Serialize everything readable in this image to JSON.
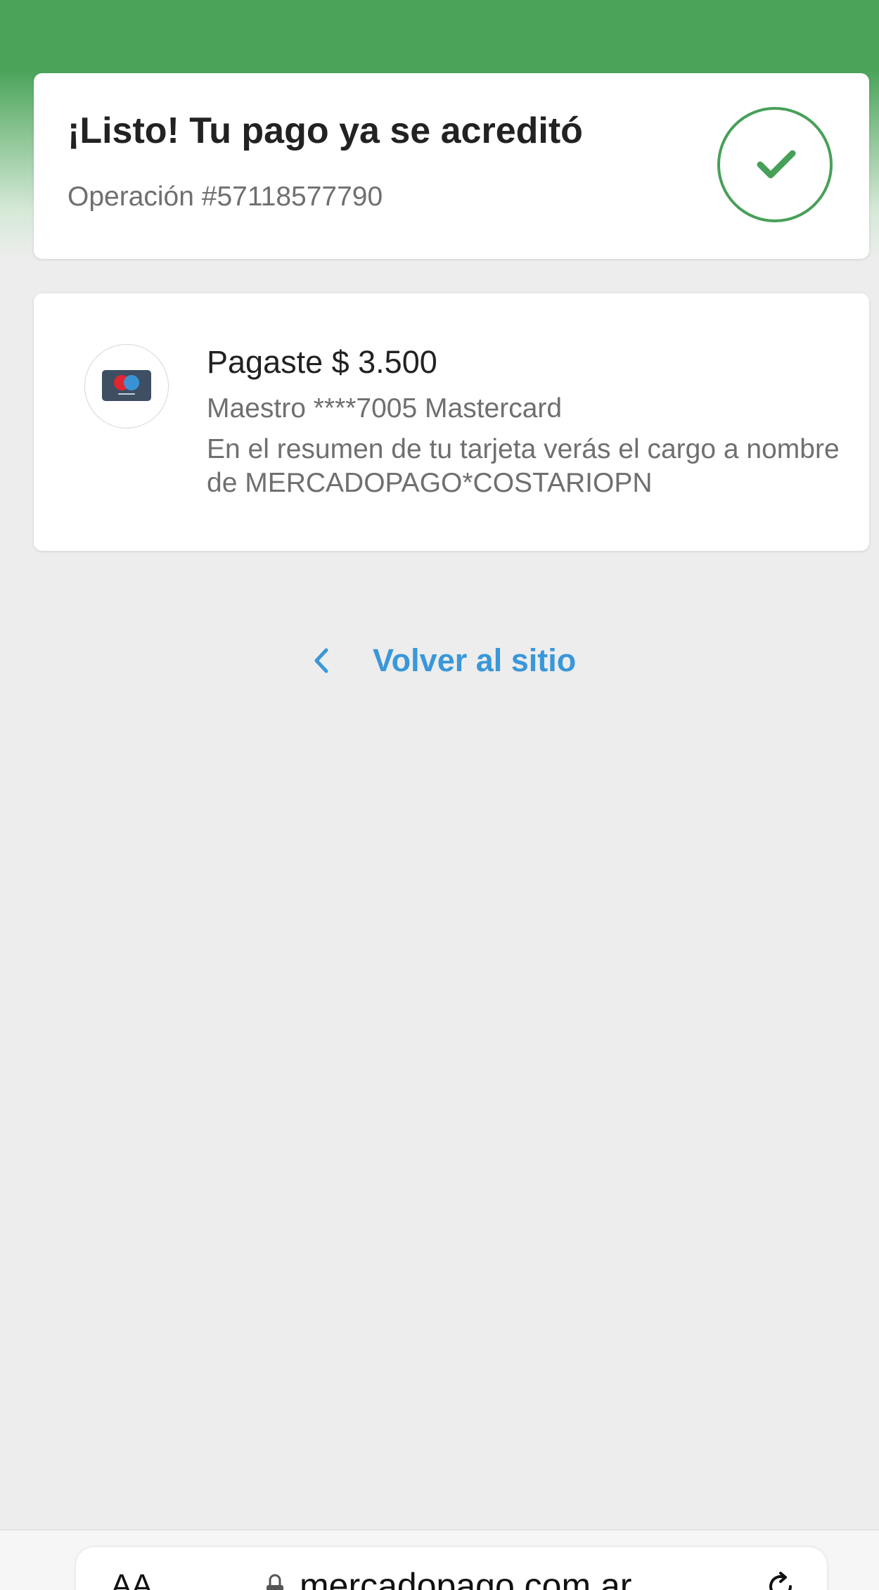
{
  "status": {
    "title": "¡Listo! Tu pago ya se acreditó",
    "operation": "Operación #57118577790",
    "icon": "check-icon",
    "accent_color": "#47a058"
  },
  "payment": {
    "amount_text": "Pagaste $ 3.500",
    "card_description": "Maestro ****7005 Mastercard",
    "statement_note": "En el resumen de tu tarjeta verás el cargo a nombre de MERCADOPAGO*COSTARIOPN",
    "card_icon": "maestro-card-icon"
  },
  "back_link": {
    "label": "Volver al sitio",
    "icon": "chevron-left-icon",
    "color": "#3a97d9"
  },
  "browser": {
    "text_size_label": "AA",
    "url": "mercadopago.com.ar",
    "lock_icon": "lock-icon",
    "reload_icon": "reload-icon"
  },
  "colors": {
    "header_green": "#4ba35a",
    "background": "#ededed"
  }
}
